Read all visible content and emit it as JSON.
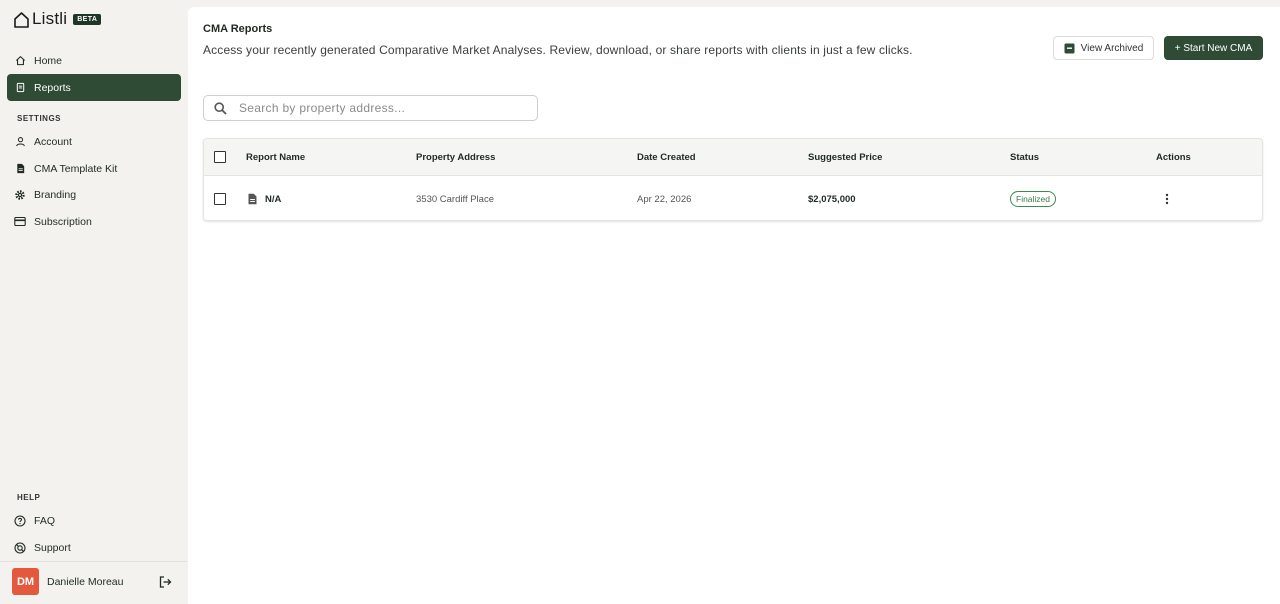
{
  "app": {
    "name": "Listli",
    "badge": "BETA"
  },
  "sidebar": {
    "nav": [
      {
        "label": "Home",
        "icon": "home-icon"
      },
      {
        "label": "Reports",
        "icon": "document-icon",
        "active": true
      }
    ],
    "settings_label": "SETTINGS",
    "settings": [
      {
        "label": "Account",
        "icon": "person-icon"
      },
      {
        "label": "CMA Template Kit",
        "icon": "file-icon"
      },
      {
        "label": "Branding",
        "icon": "gear-icon"
      },
      {
        "label": "Subscription",
        "icon": "card-icon"
      }
    ],
    "help_label": "HELP",
    "help": [
      {
        "label": "FAQ",
        "icon": "help-circle-icon"
      },
      {
        "label": "Support",
        "icon": "support-icon"
      }
    ],
    "user": {
      "initials": "DM",
      "name": "Danielle Moreau"
    }
  },
  "main": {
    "title": "CMA Reports",
    "subtitle": "Access your recently generated Comparative Market Analyses. Review, download, or share reports with clients in just a few clicks.",
    "view_archived": "View Archived",
    "start_new": "+ Start New CMA",
    "search_placeholder": "Search by property address..."
  },
  "table": {
    "headers": {
      "report_name": "Report Name",
      "property_address": "Property Address",
      "date_created": "Date Created",
      "suggested_price": "Suggested Price",
      "status": "Status",
      "actions": "Actions"
    },
    "rows": [
      {
        "report_name": "N/A",
        "property_address": "3530 Cardiff Place",
        "date_created": "Apr 22, 2026",
        "suggested_price": "$2,075,000",
        "status": "Finalized"
      }
    ]
  },
  "colors": {
    "accent": "#2f4a35",
    "avatar": "#e4593e",
    "status_green": "#3c8a52",
    "sidebar_bg": "#f3f2ee"
  }
}
